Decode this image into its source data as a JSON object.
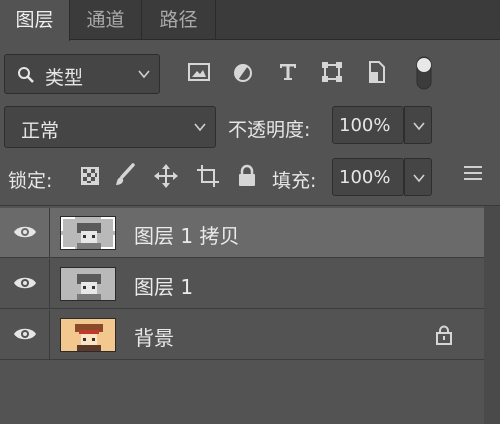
{
  "tabs": [
    {
      "label": "图层",
      "active": true
    },
    {
      "label": "通道",
      "active": false
    },
    {
      "label": "路径",
      "active": false
    }
  ],
  "filter": {
    "kind_label": "类型"
  },
  "blend": {
    "mode": "正常",
    "opacity_label": "不透明度:",
    "opacity_value": "100%"
  },
  "lock": {
    "label": "锁定:",
    "fill_label": "填充:",
    "fill_value": "100%"
  },
  "layers": [
    {
      "name": "图层 1 拷贝",
      "selected": true,
      "visible": true,
      "locked": false
    },
    {
      "name": "图层 1",
      "selected": false,
      "visible": true,
      "locked": false
    },
    {
      "name": "背景",
      "selected": false,
      "visible": true,
      "locked": true
    }
  ],
  "colors": {
    "panel_bg": "#535353",
    "tab_bar_bg": "#3b3b3b",
    "selected_row": "#6a6a6a",
    "text": "#e6e6e6"
  }
}
